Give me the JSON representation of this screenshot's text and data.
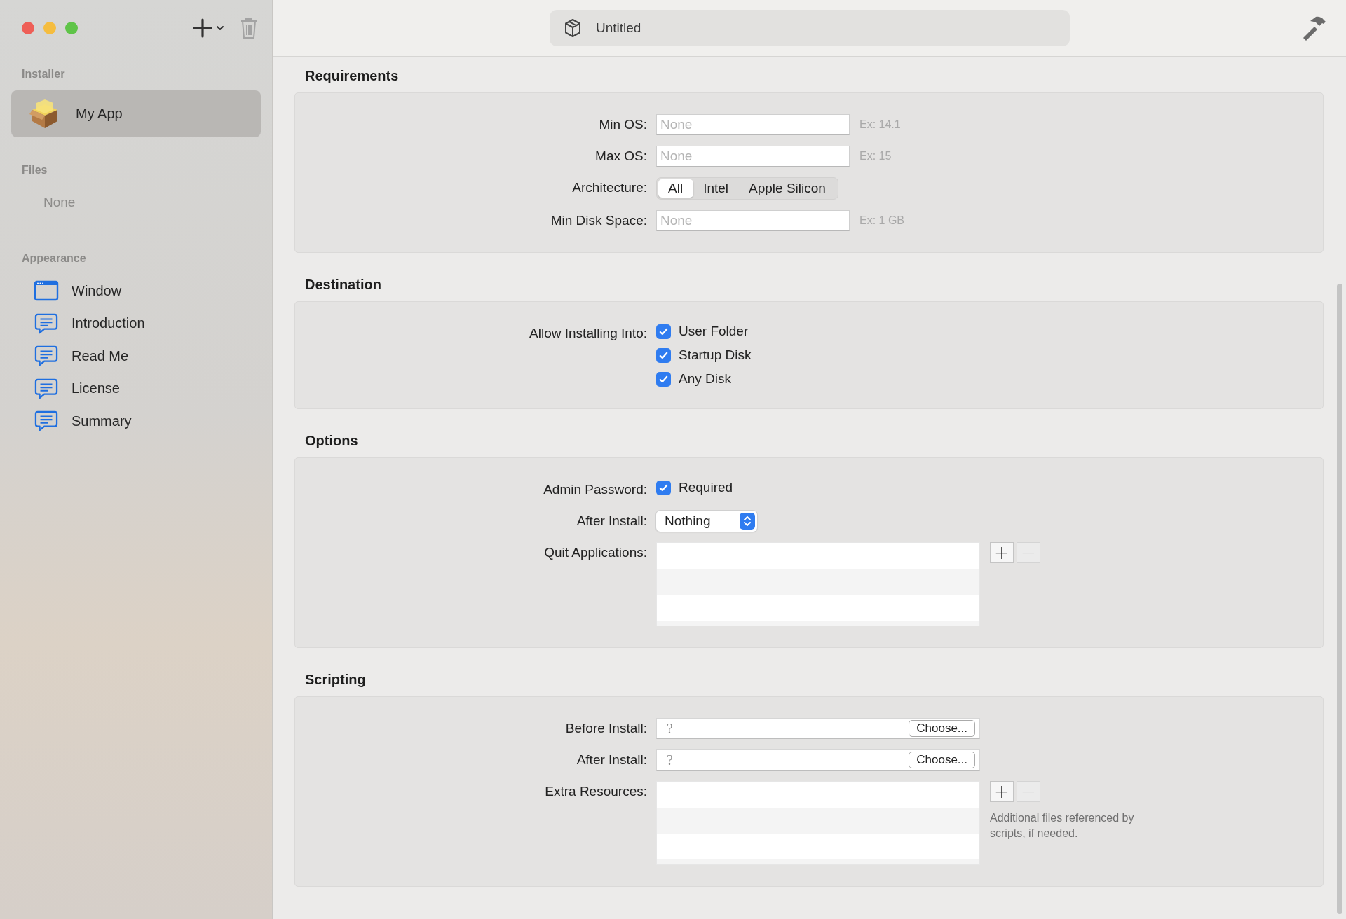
{
  "window": {
    "title": "Untitled"
  },
  "sidebar": {
    "sections": [
      {
        "header": "Installer",
        "items": [
          {
            "label": "My App",
            "kind": "package",
            "selected": true
          }
        ]
      },
      {
        "header": "Files",
        "empty_text": "None"
      },
      {
        "header": "Appearance",
        "items": [
          {
            "label": "Window",
            "kind": "window",
            "selected": false
          },
          {
            "label": "Introduction",
            "kind": "note",
            "selected": false
          },
          {
            "label": "Read Me",
            "kind": "note",
            "selected": false
          },
          {
            "label": "License",
            "kind": "note",
            "selected": false
          },
          {
            "label": "Summary",
            "kind": "note",
            "selected": false
          }
        ]
      }
    ]
  },
  "sections": [
    {
      "title": "Requirements",
      "rows": [
        {
          "kind": "text",
          "label": "Min OS:",
          "placeholder": "None",
          "hint": "Ex: 14.1"
        },
        {
          "kind": "text",
          "label": "Max OS:",
          "placeholder": "None",
          "hint": "Ex: 15"
        },
        {
          "kind": "segmented",
          "label": "Architecture:",
          "segments": [
            {
              "label": "All",
              "selected": true
            },
            {
              "label": "Intel",
              "selected": false
            },
            {
              "label": "Apple Silicon",
              "selected": false
            }
          ]
        },
        {
          "kind": "text",
          "label": "Min Disk Space:",
          "placeholder": "None",
          "hint": "Ex: 1 GB"
        }
      ]
    },
    {
      "title": "Destination",
      "rows": [
        {
          "kind": "checkboxes",
          "label": "Allow Installing Into:",
          "options": [
            {
              "label": "User Folder",
              "checked": true
            },
            {
              "label": "Startup Disk",
              "checked": true
            },
            {
              "label": "Any Disk",
              "checked": true
            }
          ]
        }
      ]
    },
    {
      "title": "Options",
      "rows": [
        {
          "kind": "checkboxes",
          "label": "Admin Password:",
          "options": [
            {
              "label": "Required",
              "checked": true
            }
          ]
        },
        {
          "kind": "popup",
          "label": "After Install:",
          "value": "Nothing"
        },
        {
          "kind": "list",
          "label": "Quit Applications:",
          "buttons": [
            {
              "label": "+",
              "disabled": false
            },
            {
              "label": "−",
              "disabled": true
            }
          ]
        }
      ]
    },
    {
      "title": "Scripting",
      "rows": [
        {
          "kind": "file",
          "label": "Before Install:",
          "glyph": "?",
          "button": "Choose..."
        },
        {
          "kind": "file",
          "label": "After Install:",
          "glyph": "?",
          "button": "Choose..."
        },
        {
          "kind": "list",
          "label": "Extra Resources:",
          "buttons": [
            {
              "label": "+",
              "disabled": false
            },
            {
              "label": "−",
              "disabled": true
            }
          ],
          "help": "Additional files referenced by scripts, if needed."
        }
      ]
    }
  ]
}
